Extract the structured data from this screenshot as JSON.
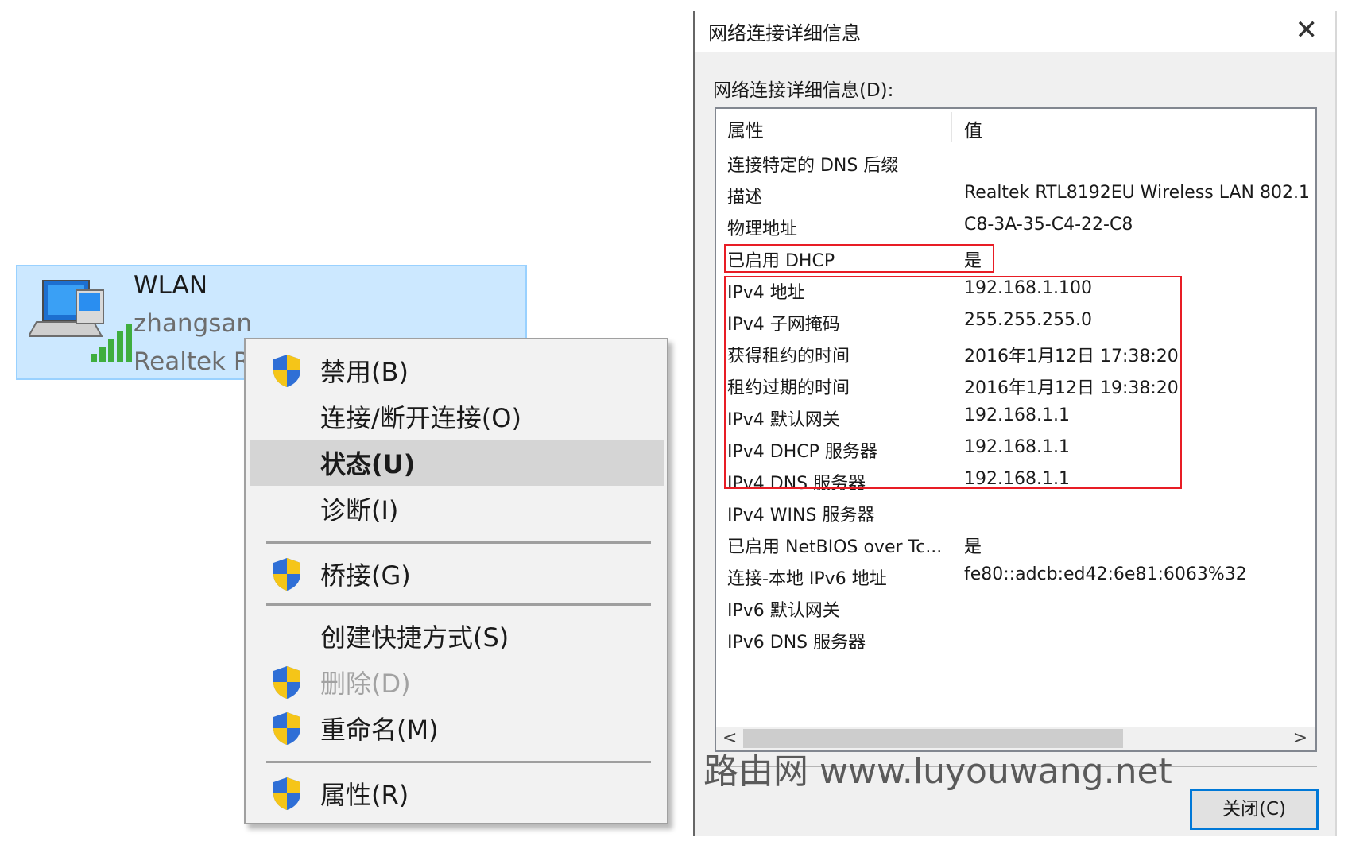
{
  "adapter": {
    "name": "WLAN",
    "user": "zhangsan",
    "device": "Realtek R"
  },
  "context_menu": {
    "items": [
      {
        "label": "禁用(B)",
        "icon": "uac-shield-icon"
      },
      {
        "label": "连接/断开连接(O)"
      },
      {
        "label": "状态(U)",
        "highlighted": true
      },
      {
        "label": "诊断(I)"
      },
      {
        "label": "桥接(G)",
        "icon": "uac-shield-icon"
      },
      {
        "label": "创建快捷方式(S)"
      },
      {
        "label": "删除(D)",
        "icon": "uac-shield-icon",
        "disabled": true
      },
      {
        "label": "重命名(M)",
        "icon": "uac-shield-icon"
      },
      {
        "label": "属性(R)",
        "icon": "uac-shield-icon"
      }
    ]
  },
  "dialog": {
    "title": "网络连接详细信息",
    "close_glyph": "✕",
    "details_label": "网络连接详细信息(D):",
    "columns": {
      "property": "属性",
      "value": "值"
    },
    "rows": [
      {
        "property": "连接特定的 DNS 后缀",
        "value": ""
      },
      {
        "property": "描述",
        "value": "Realtek RTL8192EU Wireless LAN 802.1"
      },
      {
        "property": "物理地址",
        "value": "C8-3A-35-C4-22-C8"
      },
      {
        "property": "已启用 DHCP",
        "value": "是"
      },
      {
        "property": "IPv4 地址",
        "value": "192.168.1.100"
      },
      {
        "property": "IPv4 子网掩码",
        "value": "255.255.255.0"
      },
      {
        "property": "获得租约的时间",
        "value": "2016年1月12日 17:38:20"
      },
      {
        "property": "租约过期的时间",
        "value": "2016年1月12日 19:38:20"
      },
      {
        "property": "IPv4 默认网关",
        "value": "192.168.1.1"
      },
      {
        "property": "IPv4 DHCP 服务器",
        "value": "192.168.1.1"
      },
      {
        "property": "IPv4 DNS 服务器",
        "value": "192.168.1.1"
      },
      {
        "property": "IPv4 WINS 服务器",
        "value": ""
      },
      {
        "property": "已启用 NetBIOS over Tc...",
        "value": "是"
      },
      {
        "property": "连接-本地 IPv6 地址",
        "value": "fe80::adcb:ed42:6e81:6063%32"
      },
      {
        "property": "IPv6 默认网关",
        "value": ""
      },
      {
        "property": "IPv6 DNS 服务器",
        "value": ""
      }
    ],
    "scroll_left_glyph": "<",
    "scroll_right_glyph": ">",
    "close_button_label": "关闭(C)"
  },
  "watermark": "路由网 www.luyouwang.net",
  "colors": {
    "selection": "#cce8ff",
    "highlight_box": "#e81d25",
    "focus_border": "#0078d7"
  }
}
